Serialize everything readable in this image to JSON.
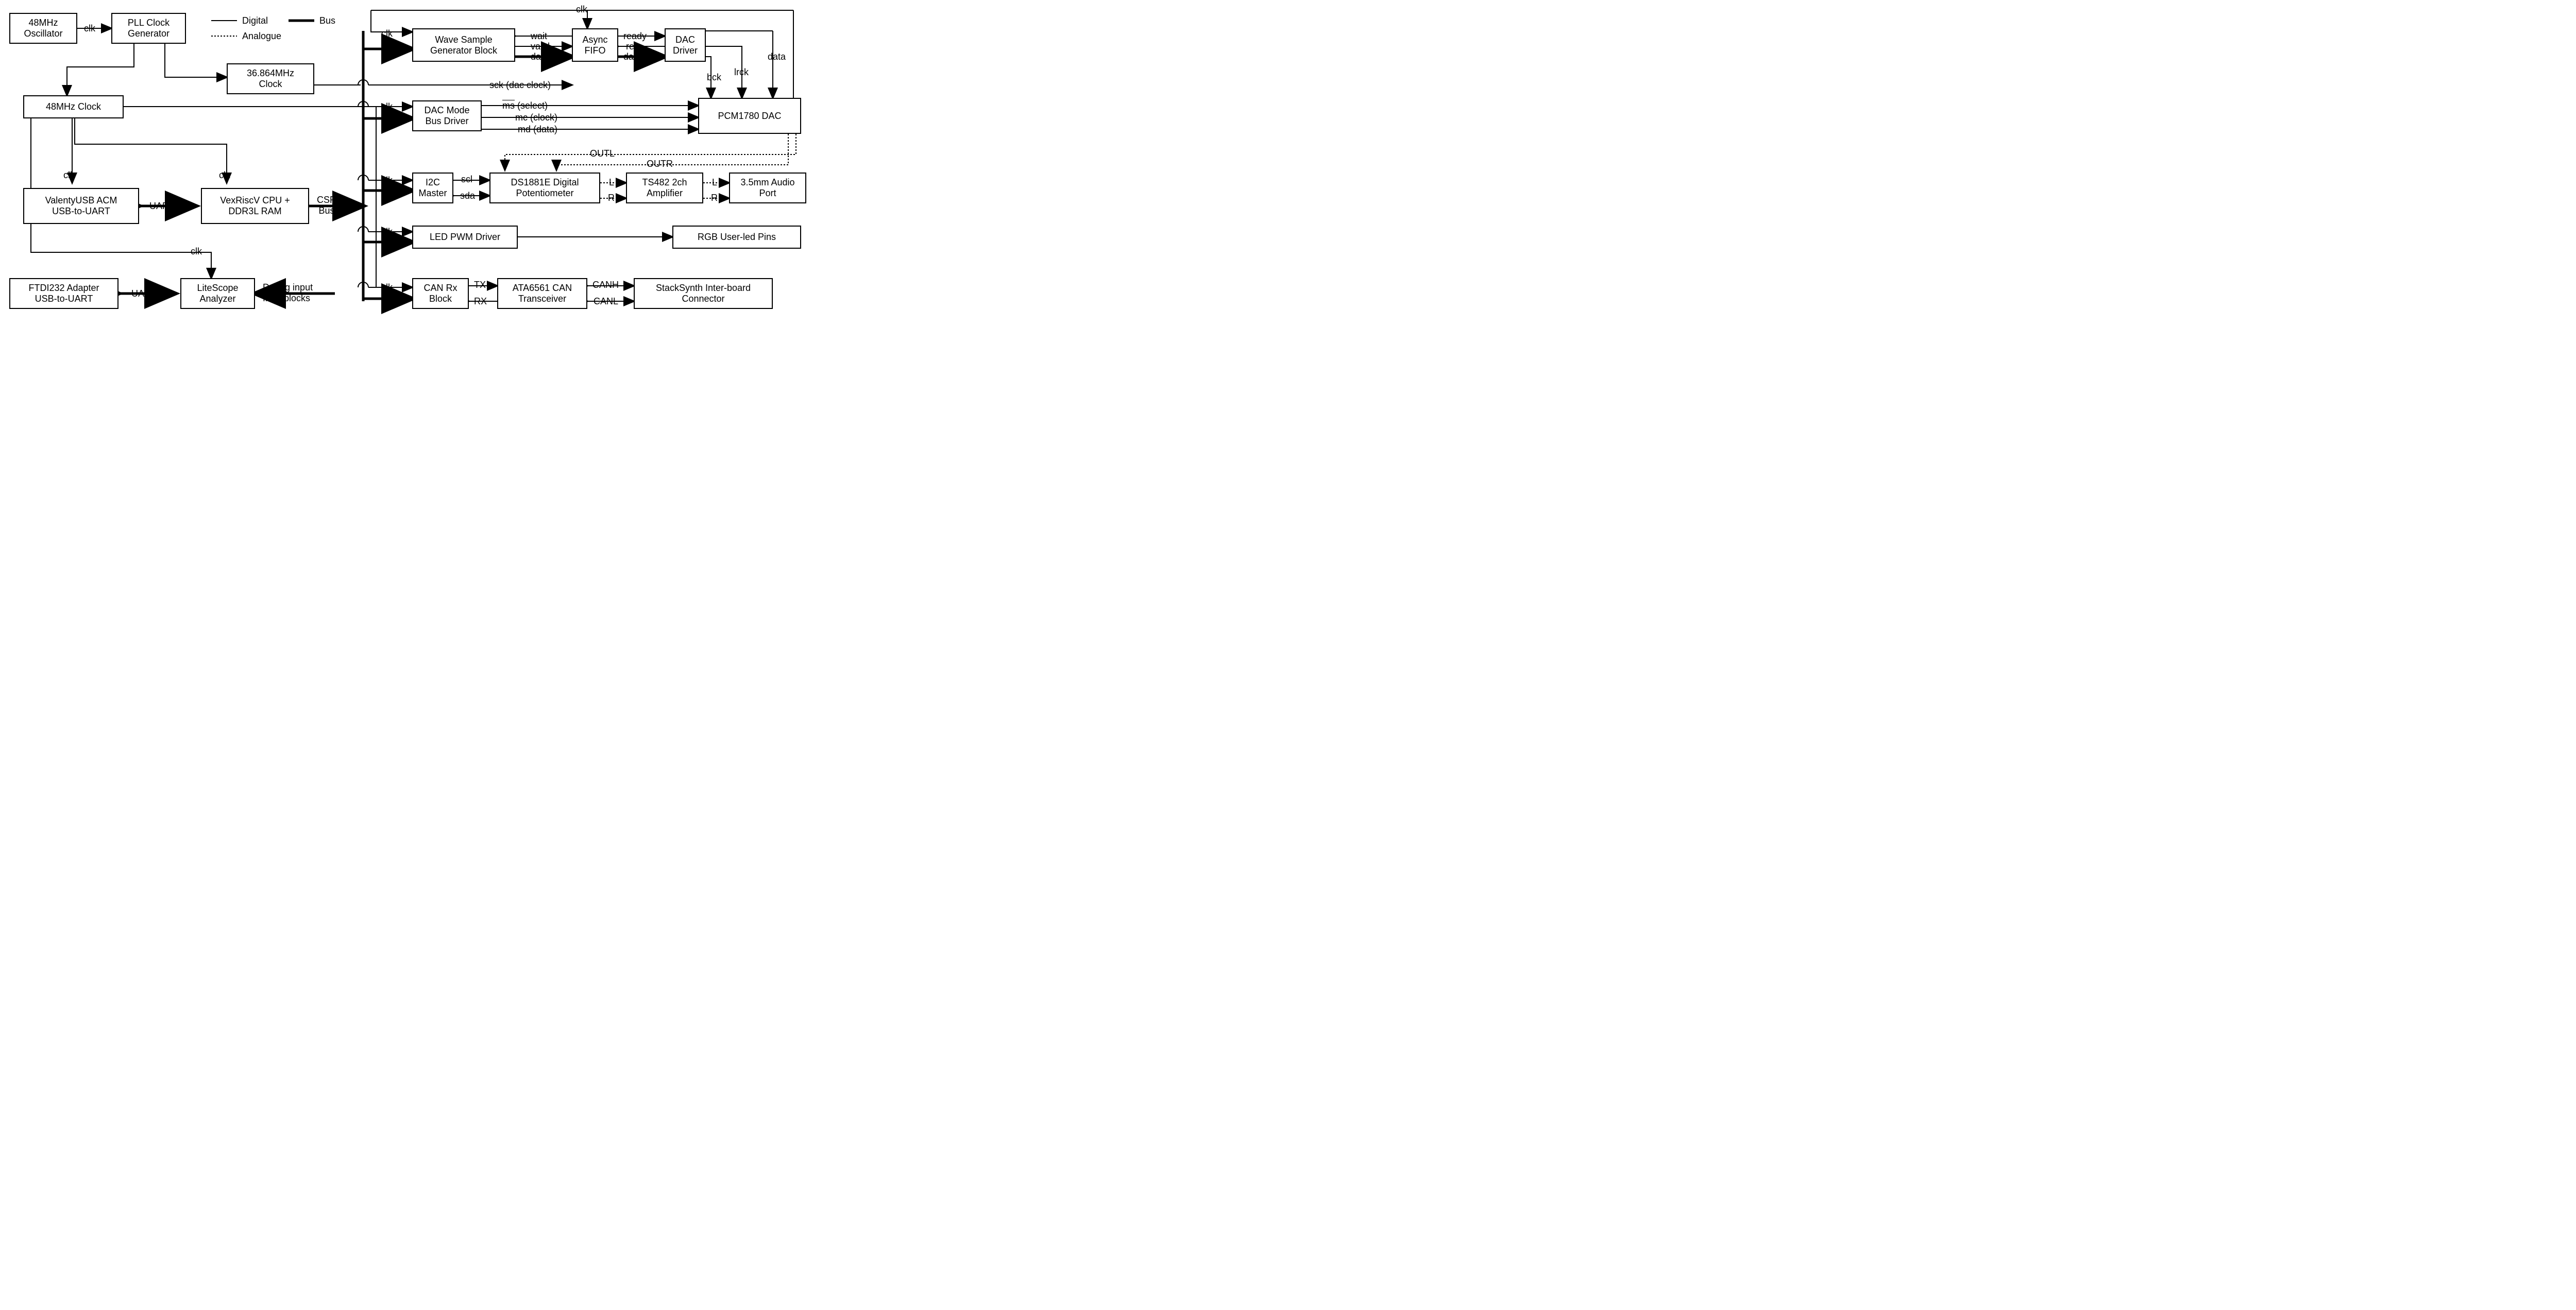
{
  "legend": {
    "digital": "Digital",
    "bus": "Bus",
    "analogue": "Analogue"
  },
  "blocks": {
    "osc48": "48MHz\nOscillator",
    "pll": "PLL Clock\nGenerator",
    "clk36": "36.864MHz\nClock",
    "clk48": "48MHz Clock",
    "valenty": "ValentyUSB ACM\nUSB-to-UART",
    "vex": "VexRiscV CPU +\nDDR3L RAM",
    "ftdi": "FTDI232 Adapter\nUSB-to-UART",
    "litescope": "LiteScope\nAnalyzer",
    "wavegen": "Wave Sample\nGenerator Block",
    "asyncfifo": "Async\nFIFO",
    "dacdriver": "DAC\nDriver",
    "dacmode": "DAC Mode\nBus Driver",
    "pcm1780": "PCM1780 DAC",
    "i2c": "I2C\nMaster",
    "ds1881": "DS1881E Digital\nPotentiometer",
    "ts482": "TS482 2ch\nAmplifier",
    "audiojack": "3.5mm Audio\nPort",
    "ledpwm": "LED PWM Driver",
    "rgbpins": "RGB User-led Pins",
    "canrx": "CAN Rx\nBlock",
    "ata6561": "ATA6561 CAN\nTransceiver",
    "stacksynth": "StackSynth Inter-board\nConnector"
  },
  "signals": {
    "clk": "clk",
    "uart": "UART",
    "csrbus": "CSR\nBus",
    "debug": "Debug input\nfrom blocks",
    "wait": "wait",
    "valid": "valid",
    "data": "data",
    "ready": "ready",
    "req": "req",
    "bck": "bck",
    "lrck": "lrck",
    "sck": "sck (dac clock)",
    "ms": "ms",
    "ms_suffix": " (select)",
    "mc": "mc (clock)",
    "md": "md (data)",
    "outl": "OUTL",
    "outr": "OUTR",
    "scl": "scl",
    "sda": "sda",
    "L": "L",
    "R": "R",
    "tx": "TX",
    "rx": "RX",
    "canh": "CANH",
    "canl": "CANL"
  }
}
